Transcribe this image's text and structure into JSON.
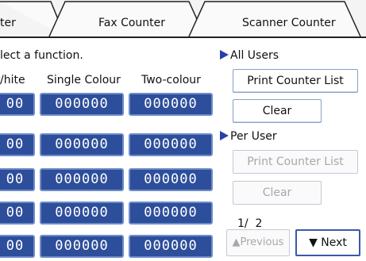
{
  "tabs": [
    {
      "label": "ter"
    },
    {
      "label": "Fax Counter"
    },
    {
      "label": "Scanner Counter"
    }
  ],
  "instruction": "lect a function.",
  "columns": [
    "/hite",
    "Single Colour",
    "Two-colour"
  ],
  "rows": [
    [
      "00",
      "000000",
      "000000"
    ],
    [
      "00",
      "000000",
      "000000"
    ],
    [
      "00",
      "000000",
      "000000"
    ],
    [
      "00",
      "000000",
      "000000"
    ],
    [
      "00",
      "000000",
      "000000"
    ]
  ],
  "all_users": {
    "label": "All Users",
    "print_counter_list": "Print Counter List",
    "clear": "Clear"
  },
  "per_user": {
    "label": "Per User",
    "print_counter_list": "Print Counter List",
    "clear": "Clear"
  },
  "pagination": {
    "indicator": "1/  2",
    "previous": "Previous",
    "next": "Next"
  },
  "colors": {
    "counter_bg": "#2d4e9b",
    "counter_border": "#6f8cc8",
    "marker": "#2840a8",
    "disabled_text": "#a8a8a8"
  }
}
